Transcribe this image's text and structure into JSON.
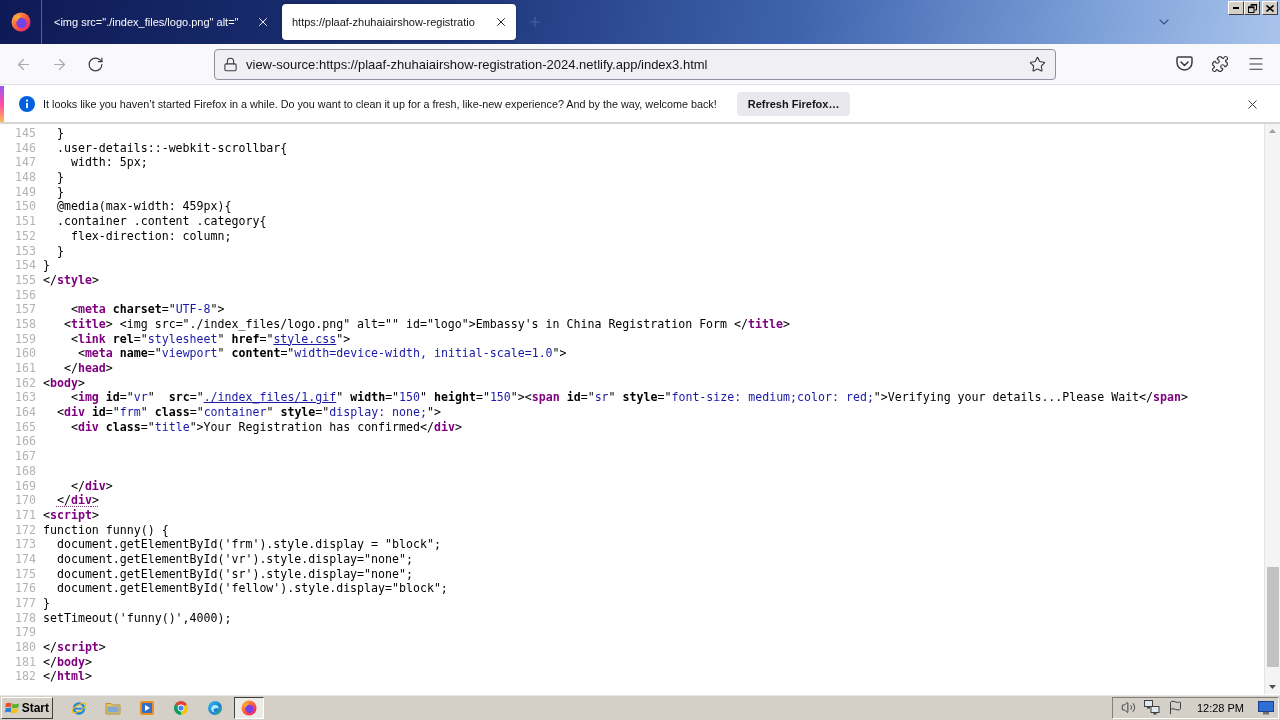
{
  "tabs": [
    {
      "title": "<img src=\"./index_files/logo.png\" alt=\"",
      "selected": false
    },
    {
      "title": "https://plaaf-zhuhaiairshow-registratio",
      "selected": true
    }
  ],
  "toolbar": {
    "buttons": [
      {
        "kind": "back",
        "disabled": true
      },
      {
        "kind": "forward",
        "disabled": true
      },
      {
        "kind": "reload",
        "disabled": false
      }
    ],
    "address_bar": {
      "value": "view-source:https://plaaf-zhuhaiairshow-registration-2024.netlify.app/index3.html"
    }
  },
  "notification": {
    "message": "It looks like you haven’t started Firefox in a while. Do you want to clean it up for a fresh, like-new experience? And by the way, welcome back!",
    "button": "Refresh Firefox…"
  },
  "source": {
    "lines": [
      {
        "number": "145",
        "segments": [
          {
            "kind": "plain",
            "text": "  }"
          }
        ]
      },
      {
        "number": "146",
        "segments": [
          {
            "kind": "plain",
            "text": "  .user-details::-webkit-scrollbar{"
          }
        ]
      },
      {
        "number": "147",
        "segments": [
          {
            "kind": "plain",
            "text": "    width: 5px;"
          }
        ]
      },
      {
        "number": "148",
        "segments": [
          {
            "kind": "plain",
            "text": "  }"
          }
        ]
      },
      {
        "number": "149",
        "segments": [
          {
            "kind": "plain",
            "text": "  }"
          }
        ]
      },
      {
        "number": "150",
        "segments": [
          {
            "kind": "plain",
            "text": "  @media(max-width: 459px){"
          }
        ]
      },
      {
        "number": "151",
        "segments": [
          {
            "kind": "plain",
            "text": "  .container .content .category{"
          }
        ]
      },
      {
        "number": "152",
        "segments": [
          {
            "kind": "plain",
            "text": "    flex-direction: column;"
          }
        ]
      },
      {
        "number": "153",
        "segments": [
          {
            "kind": "plain",
            "text": "  }"
          }
        ]
      },
      {
        "number": "154",
        "segments": [
          {
            "kind": "plain",
            "text": "}"
          }
        ]
      },
      {
        "number": "155",
        "segments": [
          {
            "kind": "plain",
            "text": "</"
          },
          {
            "kind": "tag",
            "text": "style"
          },
          {
            "kind": "plain",
            "text": ">"
          }
        ]
      },
      {
        "number": "156"
      },
      {
        "number": "157",
        "segments": [
          {
            "kind": "plain",
            "text": "    <"
          },
          {
            "kind": "tag",
            "text": "meta"
          },
          {
            "kind": "attr",
            "text": " charset"
          },
          {
            "kind": "plain",
            "text": "=\""
          },
          {
            "kind": "value",
            "text": "UTF-8"
          },
          {
            "kind": "plain",
            "text": "\">"
          }
        ]
      },
      {
        "number": "158",
        "segments": [
          {
            "kind": "plain",
            "text": "   <"
          },
          {
            "kind": "tag",
            "text": "title"
          },
          {
            "kind": "plain",
            "text": "> <img src=\"./index_files/logo.png\" alt=\"\" id=\"logo\">Embassy's in China Registration Form </"
          },
          {
            "kind": "tag",
            "text": "title"
          },
          {
            "kind": "plain",
            "text": ">"
          }
        ]
      },
      {
        "number": "159",
        "segments": [
          {
            "kind": "plain",
            "text": "    <"
          },
          {
            "kind": "tag",
            "text": "link"
          },
          {
            "kind": "attr",
            "text": " rel"
          },
          {
            "kind": "plain",
            "text": "=\""
          },
          {
            "kind": "value",
            "text": "stylesheet"
          },
          {
            "kind": "plain",
            "text": "\" "
          },
          {
            "kind": "attr",
            "text": "href"
          },
          {
            "kind": "plain",
            "text": "=\""
          },
          {
            "kind": "link",
            "text": "style.css"
          },
          {
            "kind": "plain",
            "text": "\">"
          }
        ]
      },
      {
        "number": "160",
        "segments": [
          {
            "kind": "plain",
            "text": "     <"
          },
          {
            "kind": "tag",
            "text": "meta"
          },
          {
            "kind": "attr",
            "text": " name"
          },
          {
            "kind": "plain",
            "text": "=\""
          },
          {
            "kind": "value",
            "text": "viewport"
          },
          {
            "kind": "plain",
            "text": "\" "
          },
          {
            "kind": "attr",
            "text": "content"
          },
          {
            "kind": "plain",
            "text": "=\""
          },
          {
            "kind": "value",
            "text": "width=device-width, initial-scale=1.0"
          },
          {
            "kind": "plain",
            "text": "\">"
          }
        ]
      },
      {
        "number": "161",
        "segments": [
          {
            "kind": "plain",
            "text": "   </"
          },
          {
            "kind": "tag",
            "text": "head"
          },
          {
            "kind": "plain",
            "text": ">"
          }
        ]
      },
      {
        "number": "162",
        "segments": [
          {
            "kind": "plain",
            "text": "<"
          },
          {
            "kind": "tag",
            "text": "body"
          },
          {
            "kind": "plain",
            "text": ">"
          }
        ]
      },
      {
        "number": "163",
        "segments": [
          {
            "kind": "plain",
            "text": "    <"
          },
          {
            "kind": "tag",
            "text": "img"
          },
          {
            "kind": "attr",
            "text": " id"
          },
          {
            "kind": "plain",
            "text": "=\""
          },
          {
            "kind": "value",
            "text": "vr"
          },
          {
            "kind": "plain",
            "text": "\"  "
          },
          {
            "kind": "attr",
            "text": "src"
          },
          {
            "kind": "plain",
            "text": "=\""
          },
          {
            "kind": "link",
            "text": "./index_files/1.gif"
          },
          {
            "kind": "plain",
            "text": "\" "
          },
          {
            "kind": "attr",
            "text": "width"
          },
          {
            "kind": "plain",
            "text": "=\""
          },
          {
            "kind": "value",
            "text": "150"
          },
          {
            "kind": "plain",
            "text": "\" "
          },
          {
            "kind": "attr",
            "text": "height"
          },
          {
            "kind": "plain",
            "text": "=\""
          },
          {
            "kind": "value",
            "text": "150"
          },
          {
            "kind": "plain",
            "text": "\"><"
          },
          {
            "kind": "tag",
            "text": "span"
          },
          {
            "kind": "attr",
            "text": " id"
          },
          {
            "kind": "plain",
            "text": "=\""
          },
          {
            "kind": "value",
            "text": "sr"
          },
          {
            "kind": "plain",
            "text": "\" "
          },
          {
            "kind": "attr",
            "text": "style"
          },
          {
            "kind": "plain",
            "text": "=\""
          },
          {
            "kind": "value",
            "text": "font-size: medium;color: red;"
          },
          {
            "kind": "plain",
            "text": "\">Verifying your details...Please Wait</"
          },
          {
            "kind": "tag",
            "text": "span"
          },
          {
            "kind": "plain",
            "text": ">"
          }
        ]
      },
      {
        "number": "164",
        "segments": [
          {
            "kind": "plain",
            "text": "  <"
          },
          {
            "kind": "tag",
            "text": "div"
          },
          {
            "kind": "attr",
            "text": " id"
          },
          {
            "kind": "plain",
            "text": "=\""
          },
          {
            "kind": "value",
            "text": "frm"
          },
          {
            "kind": "plain",
            "text": "\" "
          },
          {
            "kind": "attr",
            "text": "class"
          },
          {
            "kind": "plain",
            "text": "=\""
          },
          {
            "kind": "value",
            "text": "container"
          },
          {
            "kind": "plain",
            "text": "\" "
          },
          {
            "kind": "attr",
            "text": "style"
          },
          {
            "kind": "plain",
            "text": "=\""
          },
          {
            "kind": "value",
            "text": "display: none;"
          },
          {
            "kind": "plain",
            "text": "\">"
          }
        ]
      },
      {
        "number": "165",
        "segments": [
          {
            "kind": "plain",
            "text": "    <"
          },
          {
            "kind": "tag",
            "text": "div"
          },
          {
            "kind": "attr",
            "text": " class"
          },
          {
            "kind": "plain",
            "text": "=\""
          },
          {
            "kind": "value",
            "text": "title"
          },
          {
            "kind": "plain",
            "text": "\">Your Registration has confirmed</"
          },
          {
            "kind": "tag",
            "text": "div"
          },
          {
            "kind": "plain",
            "text": ">"
          }
        ]
      },
      {
        "number": "166"
      },
      {
        "number": "167"
      },
      {
        "number": "168"
      },
      {
        "number": "169",
        "segments": [
          {
            "kind": "plain",
            "text": "    </"
          },
          {
            "kind": "tag",
            "text": "div"
          },
          {
            "kind": "plain",
            "text": ">"
          }
        ]
      },
      {
        "number": "170",
        "segments": [
          {
            "kind": "marked",
            "parts": [
              {
                "kind": "plain",
                "text": "  </"
              },
              {
                "kind": "tag",
                "text": "div"
              },
              {
                "kind": "plain",
                "text": ">"
              }
            ]
          }
        ]
      },
      {
        "number": "171",
        "segments": [
          {
            "kind": "plain",
            "text": "<"
          },
          {
            "kind": "tag",
            "text": "script"
          },
          {
            "kind": "plain",
            "text": ">"
          }
        ]
      },
      {
        "number": "172",
        "segments": [
          {
            "kind": "plain",
            "text": "function funny() {"
          }
        ]
      },
      {
        "number": "173",
        "segments": [
          {
            "kind": "plain",
            "text": "  document.getElementById('frm').style.display = \"block\";"
          }
        ]
      },
      {
        "number": "174",
        "segments": [
          {
            "kind": "plain",
            "text": "  document.getElementById('vr').style.display=\"none\";"
          }
        ]
      },
      {
        "number": "175",
        "segments": [
          {
            "kind": "plain",
            "text": "  document.getElementById('sr').style.display=\"none\";"
          }
        ]
      },
      {
        "number": "176",
        "segments": [
          {
            "kind": "plain",
            "text": "  document.getElementById('fellow').style.display=\"block\";"
          }
        ]
      },
      {
        "number": "177",
        "segments": [
          {
            "kind": "plain",
            "text": "}"
          }
        ]
      },
      {
        "number": "178",
        "segments": [
          {
            "kind": "plain",
            "text": "setTimeout('funny()',4000);"
          }
        ]
      },
      {
        "number": "179"
      },
      {
        "number": "180",
        "segments": [
          {
            "kind": "plain",
            "text": "</"
          },
          {
            "kind": "tag",
            "text": "script"
          },
          {
            "kind": "plain",
            "text": ">"
          }
        ]
      },
      {
        "number": "181",
        "segments": [
          {
            "kind": "plain",
            "text": "</"
          },
          {
            "kind": "tag",
            "text": "body"
          },
          {
            "kind": "plain",
            "text": ">"
          }
        ]
      },
      {
        "number": "182",
        "segments": [
          {
            "kind": "plain",
            "text": "</"
          },
          {
            "kind": "tag",
            "text": "html"
          },
          {
            "kind": "plain",
            "text": ">"
          }
        ]
      }
    ]
  },
  "taskbar": {
    "start_button": "Start",
    "apps": [
      {
        "kind": "e_logo",
        "selected": false
      },
      {
        "kind": "folder",
        "selected": false
      },
      {
        "kind": "play_tile",
        "selected": false
      },
      {
        "kind": "ring_logo",
        "selected": false
      },
      {
        "kind": "wave_logo",
        "selected": false
      },
      {
        "kind": "orb_logo",
        "selected": true
      }
    ],
    "clock": "12:28 PM"
  }
}
